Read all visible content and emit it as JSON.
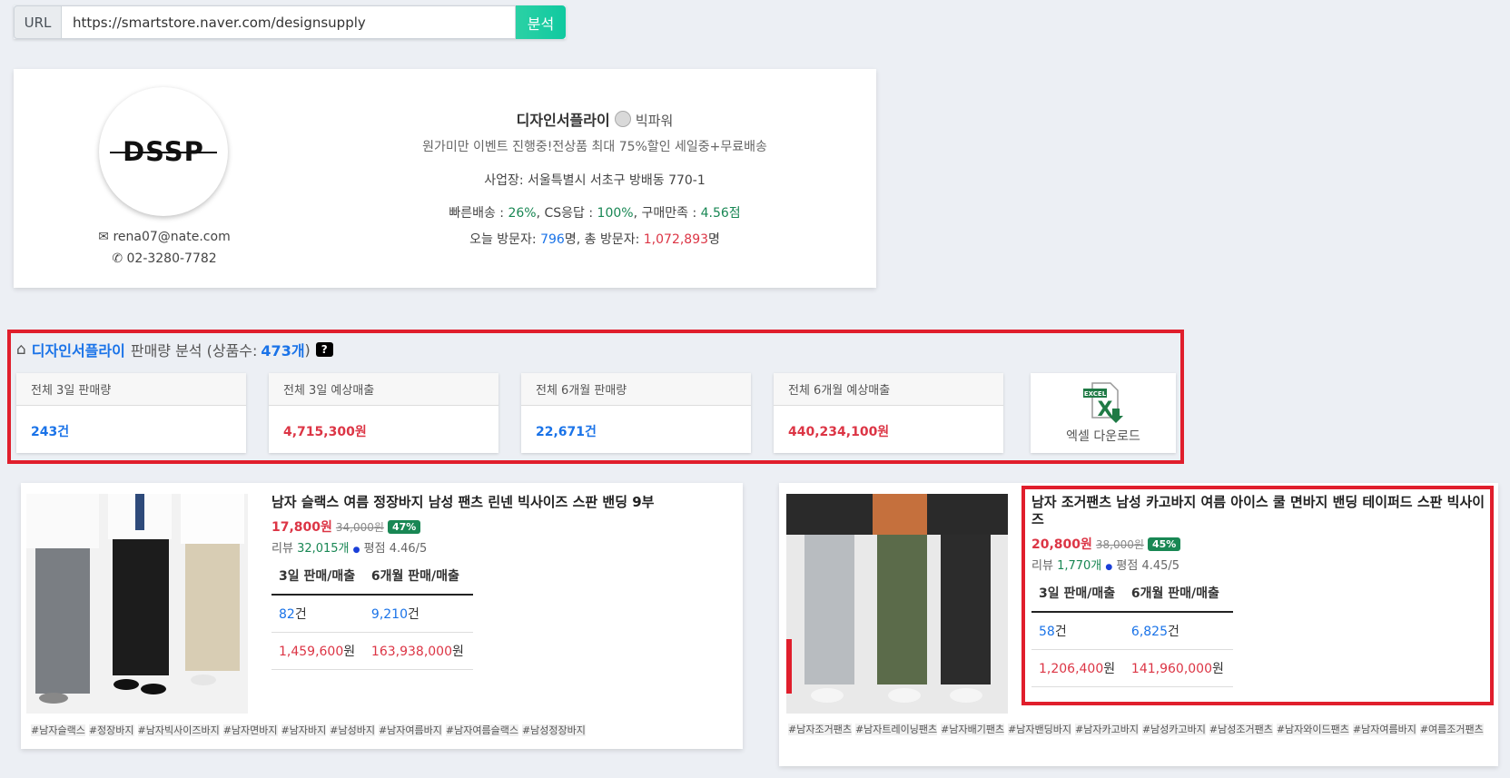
{
  "url_bar": {
    "label": "URL",
    "value": "https://smartstore.naver.com/designsupply",
    "button": "분석"
  },
  "store": {
    "logo_text": "DSSP",
    "name": "디자인서플라이",
    "grade": "빅파워",
    "description": "원가미만 이벤트 진행중!전상품 최대 75%할인 세일중+무료배송",
    "address_label": "사업장:",
    "address": "서울특별시 서초구 방배동 770-1",
    "fast_delivery_label": "빠른배송 :",
    "fast_delivery": "26%",
    "cs_label": "CS응답 :",
    "cs": "100%",
    "satisfaction_label": "구매만족 :",
    "satisfaction": "4.56점",
    "today_visitors_label": "오늘 방문자:",
    "today_visitors": "796",
    "total_visitors_label": "명, 총 방문자:",
    "total_visitors": "1,072,893",
    "unit_person": "명",
    "email": "rena07@nate.com",
    "phone": "02-3280-7782"
  },
  "analysis": {
    "store_name": "디자인서플라이",
    "title_mid": "판매량 분석 (상품수:",
    "product_count": "473개",
    "title_end": ")",
    "help": "?",
    "stats": [
      {
        "label": "전체 3일 판매량",
        "value": "243건",
        "color": "#1a73e8"
      },
      {
        "label": "전체 3일 예상매출",
        "value": "4,715,300원",
        "color": "#dc3545"
      },
      {
        "label": "전체 6개월 판매량",
        "value": "22,671건",
        "color": "#1a73e8"
      },
      {
        "label": "전체 6개월 예상매출",
        "value": "440,234,100원",
        "color": "#dc3545"
      }
    ],
    "excel_badge": "EXCEL",
    "excel_label": "엑셀 다운로드"
  },
  "products": [
    {
      "name": "남자 슬랙스 여름 정장바지 남성 팬츠 린넨 빅사이즈 스판 밴딩 9부",
      "price": "17,800원",
      "old_price": "34,000원",
      "discount": "47%",
      "review_label": "리뷰",
      "reviews": "32,015개",
      "rating_label": "평점",
      "rating": "4.46/5",
      "col1": "3일 판매/매출",
      "col2": "6개월 판매/매출",
      "sales3_num": "82",
      "sales6_num": "9,210",
      "unit_count": "건",
      "rev3_num": "1,459,600",
      "rev6_num": "163,938,000",
      "unit_won": "원",
      "tags": [
        "#남자슬랙스",
        "#정장바지",
        "#남자빅사이즈바지",
        "#남자면바지",
        "#남자바지",
        "#남성바지",
        "#남자여름바지",
        "#남자여름슬랙스",
        "#남성정장바지"
      ]
    },
    {
      "name": "남자 조거팬츠 남성 카고바지 여름 아이스 쿨 면바지 밴딩 테이퍼드 스판 빅사이즈",
      "price": "20,800원",
      "old_price": "38,000원",
      "discount": "45%",
      "review_label": "리뷰",
      "reviews": "1,770개",
      "rating_label": "평점",
      "rating": "4.45/5",
      "col1": "3일 판매/매출",
      "col2": "6개월 판매/매출",
      "sales3_num": "58",
      "sales6_num": "6,825",
      "unit_count": "건",
      "rev3_num": "1,206,400",
      "rev6_num": "141,960,000",
      "unit_won": "원",
      "tags": [
        "#남자조거팬츠",
        "#남자트레이닝팬츠",
        "#남자배기팬츠",
        "#남자밴딩바지",
        "#남자카고바지",
        "#남성카고바지",
        "#남성조거팬츠",
        "#남자와이드팬츠",
        "#남자여름바지",
        "#여름조거팬츠"
      ]
    }
  ]
}
